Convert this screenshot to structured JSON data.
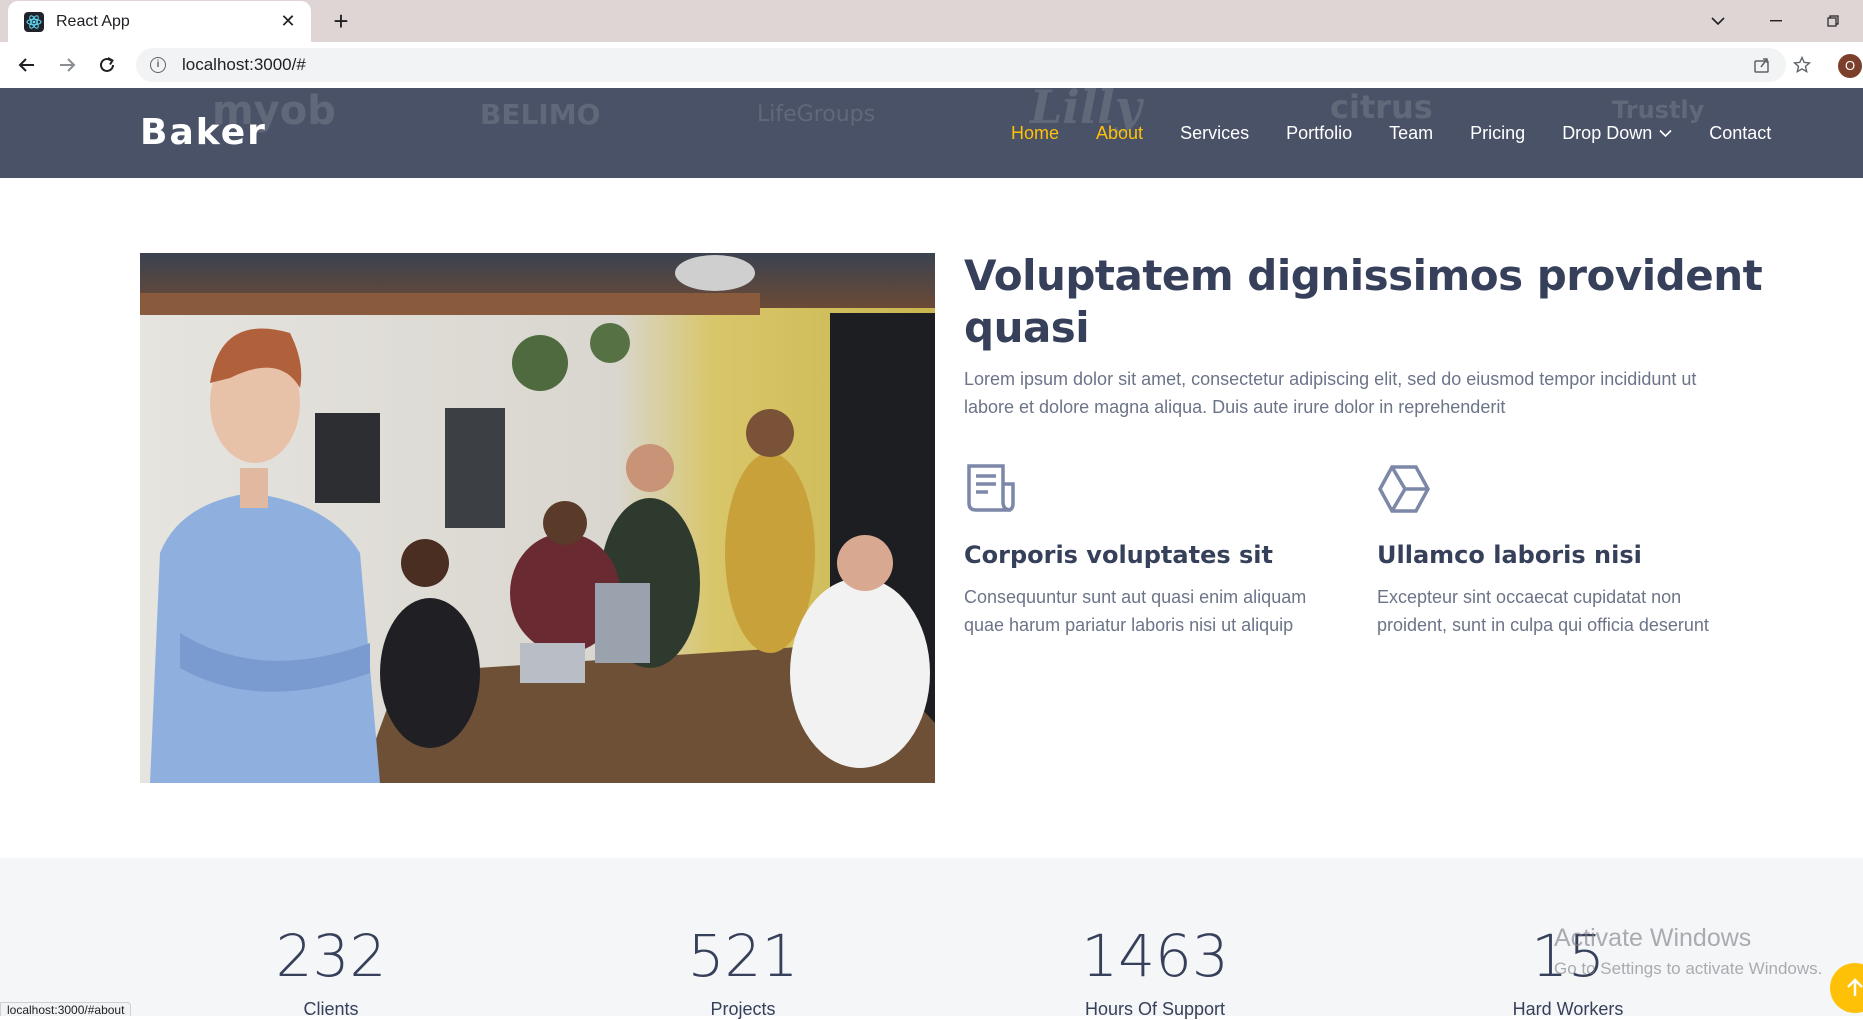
{
  "browser": {
    "tab_title": "React App",
    "url": "localhost:3000/#",
    "profile_initial": "O",
    "status_url": "localhost:3000/#about"
  },
  "header": {
    "brand": "Baker",
    "nav": [
      {
        "label": "Home",
        "active": true
      },
      {
        "label": "About",
        "active": true
      },
      {
        "label": "Services",
        "active": false
      },
      {
        "label": "Portfolio",
        "active": false
      },
      {
        "label": "Team",
        "active": false
      },
      {
        "label": "Pricing",
        "active": false
      },
      {
        "label": "Drop Down",
        "active": false
      },
      {
        "label": "Contact",
        "active": false
      }
    ],
    "background_logos": [
      "myob",
      "BELIMO",
      "LifeGroups",
      "Lilly",
      "citrus",
      "Trustly"
    ]
  },
  "about": {
    "title": "Voluptatem dignissimos provident quasi",
    "description": "Lorem ipsum dolor sit amet, consectetur adipiscing elit, sed do eiusmod tempor incididunt ut labore et dolore magna aliqua. Duis aute irure dolor in reprehenderit",
    "features": [
      {
        "icon": "receipt-icon",
        "title": "Corporis voluptates sit",
        "text": "Consequuntur sunt aut quasi enim aliquam quae harum pariatur laboris nisi ut aliquip"
      },
      {
        "icon": "cube-icon",
        "title": "Ullamco laboris nisi",
        "text": "Excepteur sint occaecat cupidatat non proident, sunt in culpa qui officia deserunt"
      }
    ]
  },
  "counts": [
    {
      "value": "232",
      "label": "Clients"
    },
    {
      "value": "521",
      "label": "Projects"
    },
    {
      "value": "1463",
      "label": "Hours Of Support"
    },
    {
      "value": "15",
      "label": "Hard Workers"
    }
  ],
  "watermark": {
    "line1": "Activate Windows",
    "line2": "Go to Settings to activate Windows."
  },
  "colors": {
    "header_bg": "#4a5267",
    "accent": "#ffc107",
    "heading": "#37405a",
    "body_text": "#6c7488"
  }
}
